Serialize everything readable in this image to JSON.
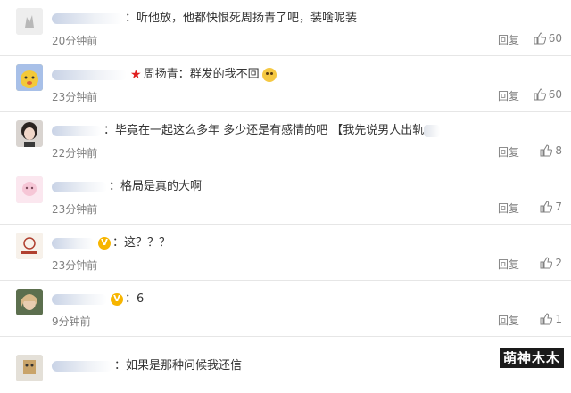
{
  "comments": [
    {
      "text": "：听他放，他都快恨死周扬青了吧，装啥呢装",
      "time": "20分钟前",
      "reply": "回复",
      "likes": "60"
    },
    {
      "text": "周扬青：群发的我不回",
      "time": "23分钟前",
      "reply": "回复",
      "likes": "60"
    },
    {
      "text": "：毕竟在一起这么多年 多少还是有感情的吧 【我先说男人出轨",
      "time": "22分钟前",
      "reply": "回复",
      "likes": "8"
    },
    {
      "text": "：格局是真的大啊",
      "time": "23分钟前",
      "reply": "回复",
      "likes": "7"
    },
    {
      "text": "：这？？？",
      "time": "23分钟前",
      "reply": "回复",
      "likes": "2"
    },
    {
      "text": "：6",
      "time": "9分钟前",
      "reply": "回复",
      "likes": "1"
    },
    {
      "text": "：如果是那种问候我还信",
      "time": "",
      "reply": "",
      "likes": ""
    }
  ],
  "watermark": "萌神木木",
  "colors": {
    "time_gray": "#808080",
    "divider": "#e6e6e6",
    "vip_badge": "#f7b500",
    "star_red": "#e02020"
  }
}
